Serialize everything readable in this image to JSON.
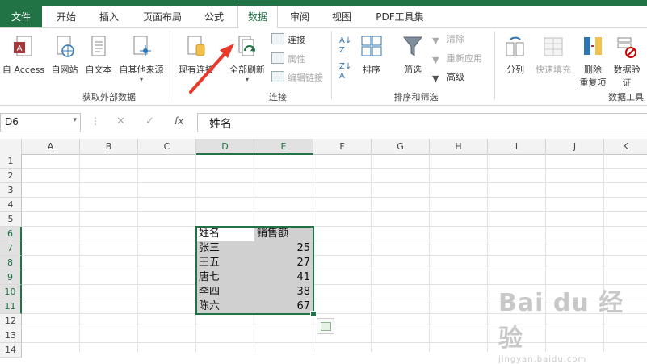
{
  "tabs": [
    {
      "label": "文件",
      "active": false
    },
    {
      "label": "开始",
      "active": false
    },
    {
      "label": "插入",
      "active": false
    },
    {
      "label": "页面布局",
      "active": false
    },
    {
      "label": "公式",
      "active": false
    },
    {
      "label": "数据",
      "active": true
    },
    {
      "label": "审阅",
      "active": false
    },
    {
      "label": "视图",
      "active": false
    },
    {
      "label": "PDF工具集",
      "active": false
    }
  ],
  "ribbon": {
    "get_external": {
      "access": "自 Access",
      "web": "自网站",
      "text": "自文本",
      "other": "自其他来源",
      "existing": "现有连接",
      "group_label": "获取外部数据"
    },
    "connections": {
      "refresh_all": "全部刷新",
      "connections": "连接",
      "properties": "属性",
      "edit_links": "编辑链接",
      "group_label": "连接"
    },
    "sort_filter": {
      "sort": "排序",
      "filter": "筛选",
      "clear": "清除",
      "reapply": "重新应用",
      "advanced": "高级",
      "group_label": "排序和筛选"
    },
    "data_tools": {
      "text_to_columns": "分列",
      "flash_fill": "快速填充",
      "remove_dup_line1": "删除",
      "remove_dup_line2": "重复项",
      "validation_line1": "数据验",
      "validation_line2": "证",
      "group_label": "数据工具"
    }
  },
  "formula_bar": {
    "name_box": "D6",
    "cancel_glyph": "✕",
    "enter_glyph": "✓",
    "fx_label": "fx",
    "formula": "姓名"
  },
  "columns": [
    "A",
    "B",
    "C",
    "D",
    "E",
    "F",
    "G",
    "H",
    "I",
    "J",
    "K"
  ],
  "rows": [
    "1",
    "2",
    "3",
    "4",
    "5",
    "6",
    "7",
    "8",
    "9",
    "10",
    "11",
    "12",
    "13",
    "14"
  ],
  "table": {
    "headers": [
      "姓名",
      "销售额"
    ],
    "rows": [
      {
        "name": "张三",
        "sales": "25"
      },
      {
        "name": "王五",
        "sales": "27"
      },
      {
        "name": "唐七",
        "sales": "41"
      },
      {
        "name": "李四",
        "sales": "38"
      },
      {
        "name": "陈六",
        "sales": "67"
      }
    ]
  },
  "watermark": {
    "main": "Bai du 经验",
    "url": "jingyan.baidu.com"
  },
  "colors": {
    "accent": "#217346",
    "arrow": "#e8392b"
  }
}
